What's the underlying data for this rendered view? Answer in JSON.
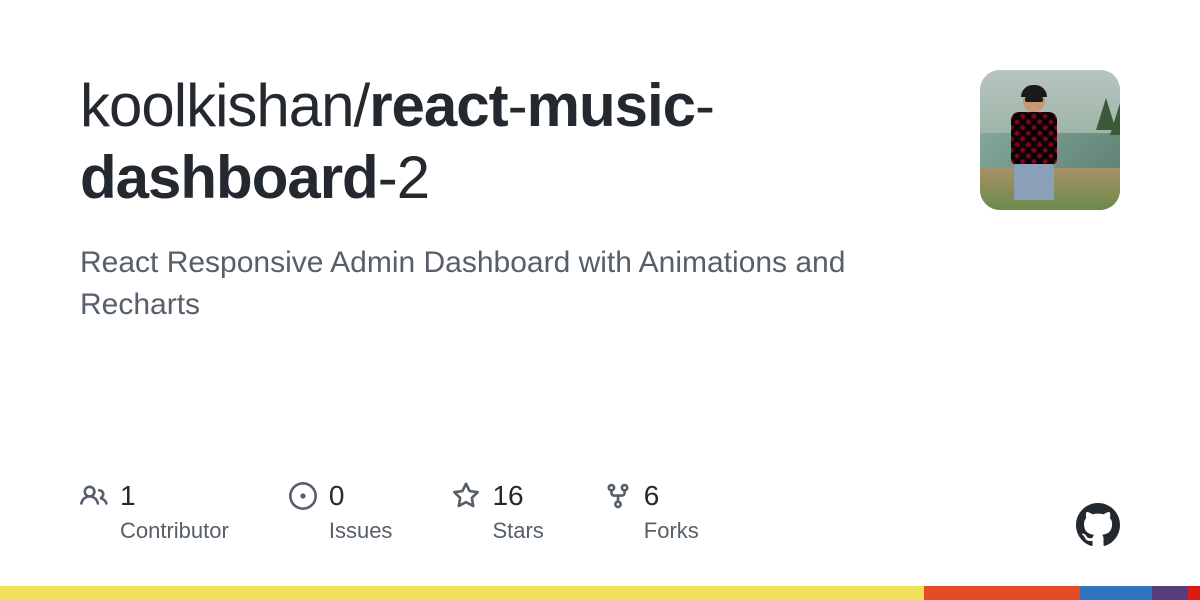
{
  "repo": {
    "owner": "koolkishan",
    "sep1": "/",
    "name1": "react",
    "sep2": "-",
    "name2": "music",
    "sep3": "-",
    "name3": "dashboard",
    "sep4": "-",
    "name4": "2"
  },
  "description": "React Responsive Admin Dashboard with Animations and Recharts",
  "stats": {
    "contributors": {
      "value": "1",
      "label": "Contributor"
    },
    "issues": {
      "value": "0",
      "label": "Issues"
    },
    "stars": {
      "value": "16",
      "label": "Stars"
    },
    "forks": {
      "value": "6",
      "label": "Forks"
    }
  }
}
